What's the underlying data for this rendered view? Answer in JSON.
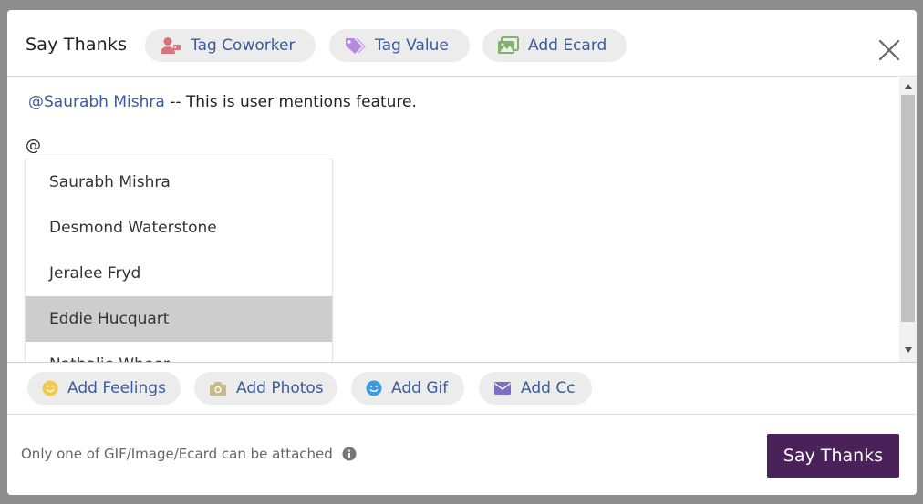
{
  "modal": {
    "title": "Say Thanks",
    "header_buttons": [
      {
        "label": "Tag Coworker",
        "icon": "user-tag-icon",
        "icon_color": "#d9737e"
      },
      {
        "label": "Tag Value",
        "icon": "tag-icon",
        "icon_color": "#b58be0"
      },
      {
        "label": "Add Ecard",
        "icon": "image-icon",
        "icon_color": "#7fb26b"
      }
    ]
  },
  "editor": {
    "mention": "@Saurabh Mishra",
    "text": " -- This is user mentions feature.",
    "current_input": "@",
    "suggestions": [
      {
        "name": "Saurabh Mishra",
        "highlighted": false
      },
      {
        "name": "Desmond Waterstone",
        "highlighted": false
      },
      {
        "name": "Jeralee Fryd",
        "highlighted": false
      },
      {
        "name": "Eddie Hucquart",
        "highlighted": true
      },
      {
        "name": "Nathalie Wheer",
        "highlighted": false
      }
    ]
  },
  "actions": [
    {
      "label": "Add Feelings",
      "icon": "smile-icon",
      "icon_color": "#f2c94c"
    },
    {
      "label": "Add Photos",
      "icon": "camera-icon",
      "icon_color": "#c7b98a"
    },
    {
      "label": "Add Gif",
      "icon": "gif-smile-icon",
      "icon_color": "#3b9be0"
    },
    {
      "label": "Add Cc",
      "icon": "envelope-icon",
      "icon_color": "#7a6fc2"
    }
  ],
  "footer": {
    "note": "Only one of GIF/Image/Ecard can be attached",
    "submit_label": "Say Thanks"
  },
  "colors": {
    "accent": "#4a2158",
    "link": "#3b5b9c",
    "pill_bg": "#ececec",
    "highlight_bg": "#cdcdcd"
  }
}
